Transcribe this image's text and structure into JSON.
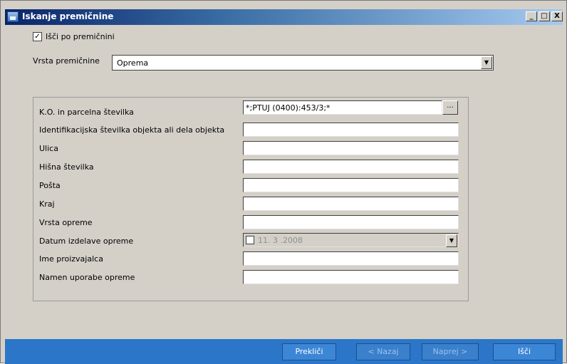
{
  "window": {
    "title": "Iskanje premičnine",
    "minimize": "_",
    "restore": "□",
    "close": "X"
  },
  "search_checkbox": {
    "checked": true,
    "label": "Išči po premičnini"
  },
  "property_type": {
    "label": "Vrsta premičnine",
    "value": "Oprema"
  },
  "fields": {
    "parcel": {
      "label": "K.O. in parcelna številka",
      "value": "*;PTUJ (0400):453/3;*",
      "browse": "..."
    },
    "object_id": {
      "label": "Identifikacijska številka objekta ali dela objekta",
      "value": ""
    },
    "street": {
      "label": "Ulica",
      "value": ""
    },
    "house_number": {
      "label": "Hišna številka",
      "value": ""
    },
    "post": {
      "label": "Pošta",
      "value": ""
    },
    "place": {
      "label": "Kraj",
      "value": ""
    },
    "equipment_type": {
      "label": "Vrsta opreme",
      "value": ""
    },
    "manufacture_date": {
      "label": "Datum izdelave opreme",
      "value": "11. 3 .2008",
      "enabled": false
    },
    "manufacturer": {
      "label": "Ime proizvajalca",
      "value": ""
    },
    "purpose": {
      "label": "Namen uporabe opreme",
      "value": ""
    }
  },
  "buttons": {
    "cancel": "Prekliči",
    "back": "< Nazaj",
    "next": "Naprej >",
    "search": "Išči"
  },
  "colors": {
    "bottom_bar": "#2b76c9",
    "title_start": "#0a246a",
    "title_end": "#a6caf0"
  }
}
